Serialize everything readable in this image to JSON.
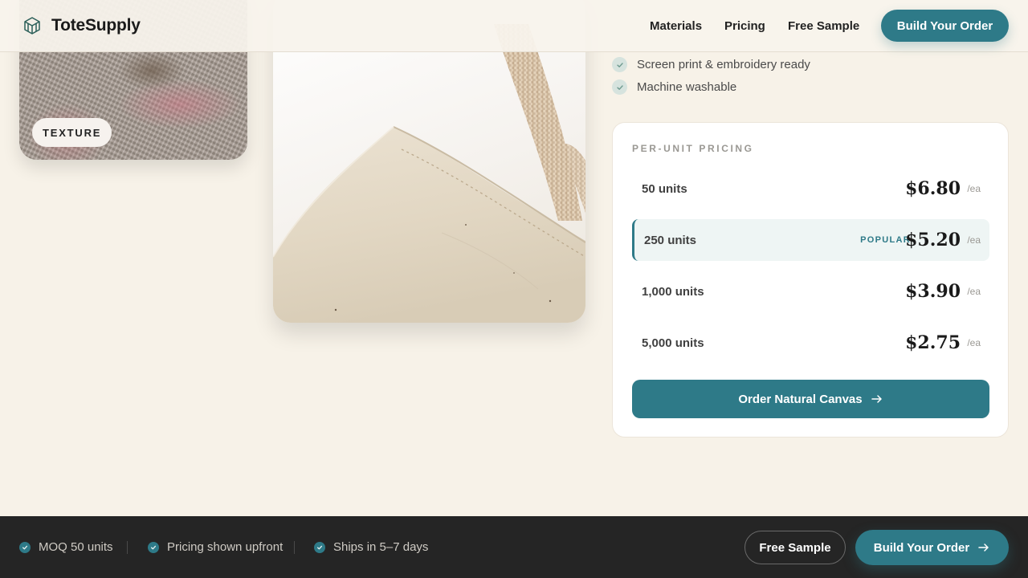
{
  "header": {
    "brand": "ToteSupply",
    "nav": [
      "Materials",
      "Pricing",
      "Free Sample"
    ],
    "cta_label": "Build Your Order"
  },
  "gallery": {
    "texture_badge": "TEXTURE"
  },
  "features": [
    "Screen print & embroidery ready",
    "Machine washable"
  ],
  "pricing": {
    "title": "PER-UNIT PRICING",
    "tiers": [
      {
        "qty": "50 units",
        "price": "$6.80",
        "unit": "/ea"
      },
      {
        "qty": "250 units",
        "price": "$5.20",
        "unit": "/ea",
        "badge": "POPULAR"
      },
      {
        "qty": "1,000 units",
        "price": "$3.90",
        "unit": "/ea"
      },
      {
        "qty": "5,000 units",
        "price": "$2.75",
        "unit": "/ea"
      }
    ],
    "order_label": "Order Natural Canvas"
  },
  "bottom_bar": {
    "trust_items": [
      "MOQ 50 units",
      "Pricing shown upfront",
      "Ships in 5–7 days"
    ],
    "sample_label": "Free Sample",
    "cta_label": "Build Your Order"
  },
  "colors": {
    "accent": "#2e7a88",
    "background": "#f7f2e8",
    "bar": "#252525"
  },
  "icons": {
    "logo": "box-logo-icon",
    "feature": "check-icon",
    "arrow": "arrow-right-icon"
  }
}
